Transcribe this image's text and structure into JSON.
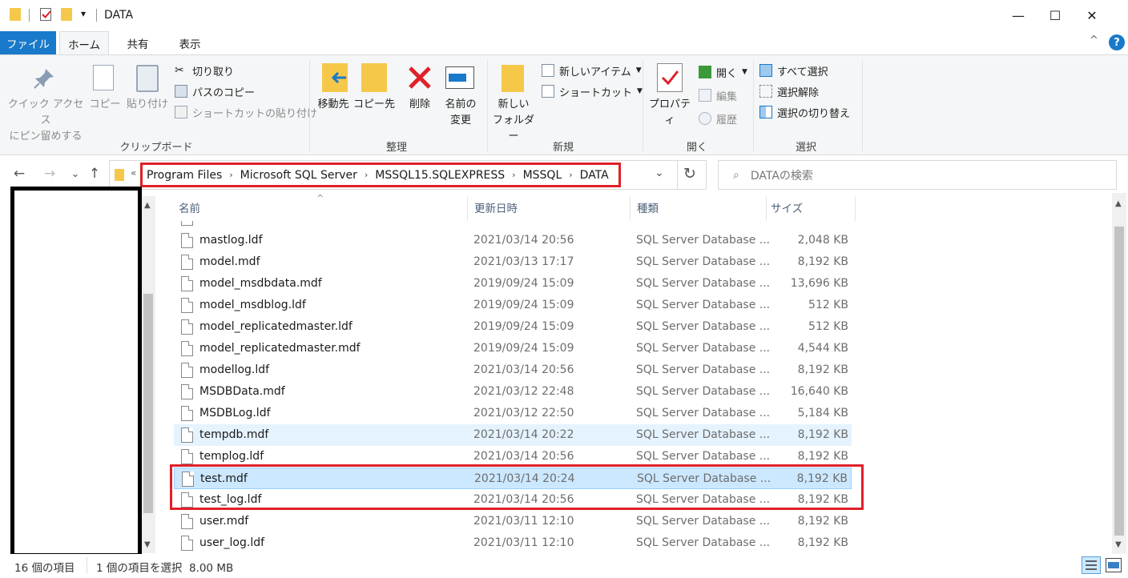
{
  "window": {
    "title": "DATA",
    "minimize_glyph": "—",
    "maximize_glyph": "☐",
    "close_glyph": "✕",
    "quick_access_dropdown": "▾"
  },
  "ribbon_tabs": {
    "file": "ファイル",
    "home": "ホーム",
    "share": "共有",
    "view": "表示",
    "help_glyph": "?",
    "collapse_glyph": "^"
  },
  "clipboard": {
    "pin_label_1": "クイック アクセス",
    "pin_label_2": "にピン留めする",
    "copy": "コピー",
    "paste": "貼り付け",
    "cut": "切り取り",
    "copy_path": "パスのコピー",
    "paste_shortcut": "ショートカットの貼り付け",
    "group": "クリップボード"
  },
  "organize": {
    "move_to": "移動先",
    "copy_to": "コピー先",
    "delete": "削除",
    "rename_1": "名前の",
    "rename_2": "変更",
    "group": "整理"
  },
  "new": {
    "new_folder_1": "新しい",
    "new_folder_2": "フォルダー",
    "new_item": "新しいアイテム",
    "shortcut": "ショートカット",
    "group": "新規"
  },
  "open": {
    "properties": "プロパティ",
    "open": "開く",
    "edit": "編集",
    "history": "履歴",
    "group": "開く"
  },
  "select": {
    "select_all": "すべて選択",
    "select_none": "選択解除",
    "invert": "選択の切り替え",
    "group": "選択"
  },
  "nav": {
    "back": "←",
    "forward": "→",
    "recent": "⌄",
    "up": "↑",
    "overflow": "«",
    "breadcrumbs": [
      "Program Files",
      "Microsoft SQL Server",
      "MSSQL15.SQLEXPRESS",
      "MSSQL",
      "DATA"
    ],
    "crumb_sep": "›",
    "refresh": "↻",
    "dropdown": "⌄",
    "search_placeholder": "DATAの検索"
  },
  "columns": {
    "name": "名前",
    "date": "更新日時",
    "type": "種類",
    "size": "サイズ",
    "sort_glyph": "^"
  },
  "files": [
    {
      "name": "mastlog.ldf",
      "date": "2021/03/14 20:56",
      "type": "SQL Server Database ...",
      "size": "2,048 KB"
    },
    {
      "name": "model.mdf",
      "date": "2021/03/13 17:17",
      "type": "SQL Server Database ...",
      "size": "8,192 KB"
    },
    {
      "name": "model_msdbdata.mdf",
      "date": "2019/09/24 15:09",
      "type": "SQL Server Database ...",
      "size": "13,696 KB"
    },
    {
      "name": "model_msdblog.ldf",
      "date": "2019/09/24 15:09",
      "type": "SQL Server Database ...",
      "size": "512 KB"
    },
    {
      "name": "model_replicatedmaster.ldf",
      "date": "2019/09/24 15:09",
      "type": "SQL Server Database ...",
      "size": "512 KB"
    },
    {
      "name": "model_replicatedmaster.mdf",
      "date": "2019/09/24 15:09",
      "type": "SQL Server Database ...",
      "size": "4,544 KB"
    },
    {
      "name": "modellog.ldf",
      "date": "2021/03/14 20:56",
      "type": "SQL Server Database ...",
      "size": "8,192 KB"
    },
    {
      "name": "MSDBData.mdf",
      "date": "2021/03/12 22:48",
      "type": "SQL Server Database ...",
      "size": "16,640 KB"
    },
    {
      "name": "MSDBLog.ldf",
      "date": "2021/03/12 22:50",
      "type": "SQL Server Database ...",
      "size": "5,184 KB"
    },
    {
      "name": "tempdb.mdf",
      "date": "2021/03/14 20:22",
      "type": "SQL Server Database ...",
      "size": "8,192 KB"
    },
    {
      "name": "templog.ldf",
      "date": "2021/03/14 20:56",
      "type": "SQL Server Database ...",
      "size": "8,192 KB"
    },
    {
      "name": "test.mdf",
      "date": "2021/03/14 20:24",
      "type": "SQL Server Database ...",
      "size": "8,192 KB"
    },
    {
      "name": "test_log.ldf",
      "date": "2021/03/14 20:56",
      "type": "SQL Server Database ...",
      "size": "8,192 KB"
    },
    {
      "name": "user.mdf",
      "date": "2021/03/11 12:10",
      "type": "SQL Server Database ...",
      "size": "8,192 KB"
    },
    {
      "name": "user_log.ldf",
      "date": "2021/03/11 12:10",
      "type": "SQL Server Database ...",
      "size": "8,192 KB"
    }
  ],
  "status": {
    "item_count": "16 個の項目",
    "selection": "1 個の項目を選択  8.00 MB"
  },
  "colors": {
    "accent": "#1979ca",
    "highlight_red": "#e0202a",
    "selected_row": "#cce8ff"
  }
}
